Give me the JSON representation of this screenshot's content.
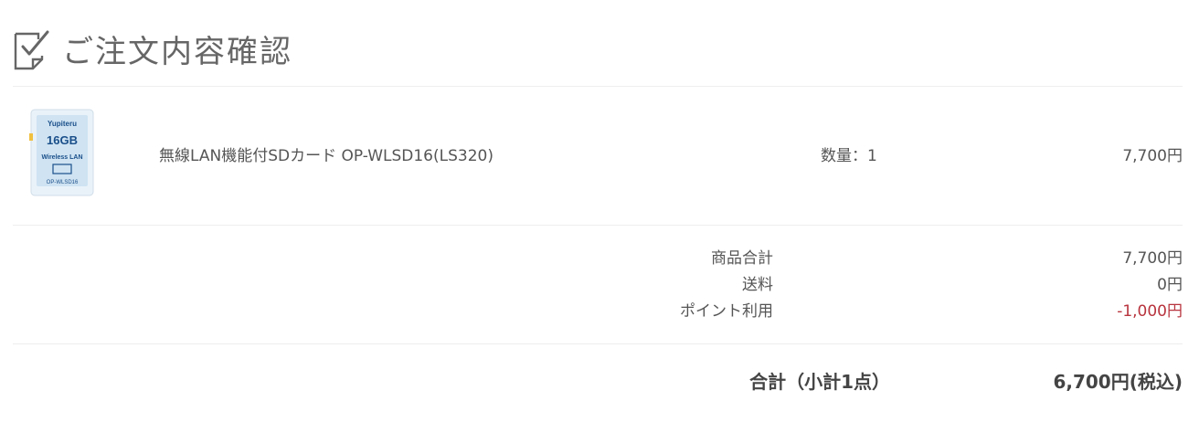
{
  "page": {
    "title": "ご注文内容確認"
  },
  "product": {
    "image": {
      "brand": "Yupiteru",
      "capacity": "16GB",
      "caption": "Wireless LAN",
      "model_code": "OP-WLSD16",
      "bg_color": "#cfe3f2"
    },
    "name": "無線LAN機能付SDカード OP-WLSD16(LS320)",
    "quantity_label": "数量",
    "quantity_sep": "：",
    "quantity_value": "1",
    "price": "7,700円"
  },
  "summary": {
    "rows": [
      {
        "label": "商品合計",
        "value": "7,700円"
      },
      {
        "label": "送料",
        "value": "0円"
      },
      {
        "label": "ポイント利用",
        "value": "-1,000円"
      }
    ],
    "negative_color": "#b8343e"
  },
  "total": {
    "label": "合計（小計1点）",
    "value": "6,700円(税込)"
  }
}
